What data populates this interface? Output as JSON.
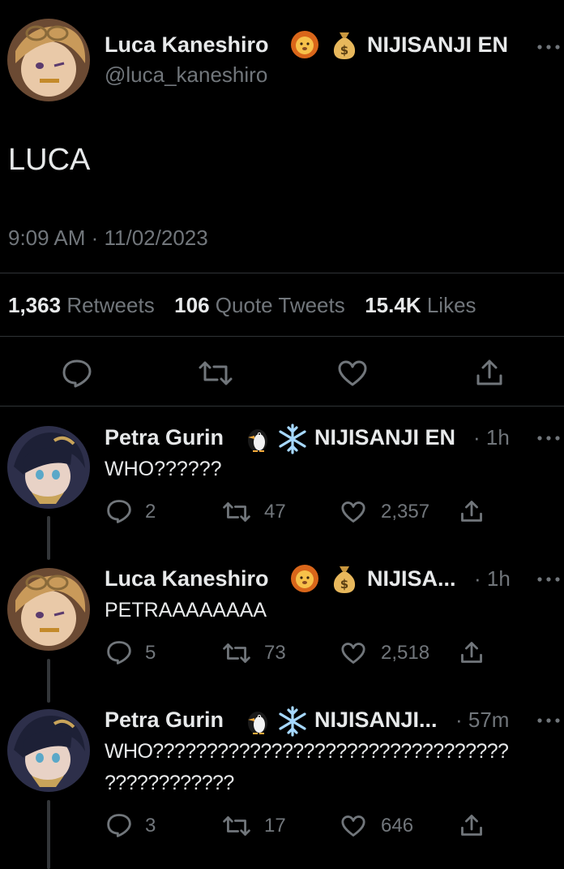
{
  "main_tweet": {
    "display_name": "Luca Kaneshiro",
    "badge_text": "NIJISANJI EN",
    "handle": "@luca_kaneshiro",
    "text": "LUCA",
    "timestamp": "9:09 AM · 11/02/2023",
    "stats": {
      "retweets_count": "1,363",
      "retweets_label": "Retweets",
      "quotes_count": "106",
      "quotes_label": "Quote Tweets",
      "likes_count": "15.4K",
      "likes_label": "Likes"
    }
  },
  "replies": [
    {
      "display_name": "Petra Gurin",
      "badge_text": "NIJISANJI EN",
      "time": "· 1h",
      "text": "WHO??????",
      "text2": "",
      "replies": "2",
      "retweets": "47",
      "likes": "2,357"
    },
    {
      "display_name": "Luca Kaneshiro",
      "badge_text": "NIJISA...",
      "time": "· 1h",
      "text": "PETRAAAAAAAA",
      "text2": "",
      "replies": "5",
      "retweets": "73",
      "likes": "2,518"
    },
    {
      "display_name": "Petra Gurin",
      "badge_text": "NIJISANJI...",
      "time": "· 57m",
      "text": "WHO?????????????????????????????????",
      "text2": "????????????",
      "replies": "3",
      "retweets": "17",
      "likes": "646"
    }
  ],
  "colors": {
    "background": "#000000",
    "text": "#e7e9ea",
    "muted": "#71767b",
    "divider": "#2f3336"
  },
  "icons": [
    "lion-emoji-icon",
    "money-bag-emoji-icon",
    "penguin-emoji-icon",
    "snowflake-emoji-icon",
    "reply-icon",
    "retweet-icon",
    "like-icon",
    "share-icon",
    "more-icon"
  ]
}
